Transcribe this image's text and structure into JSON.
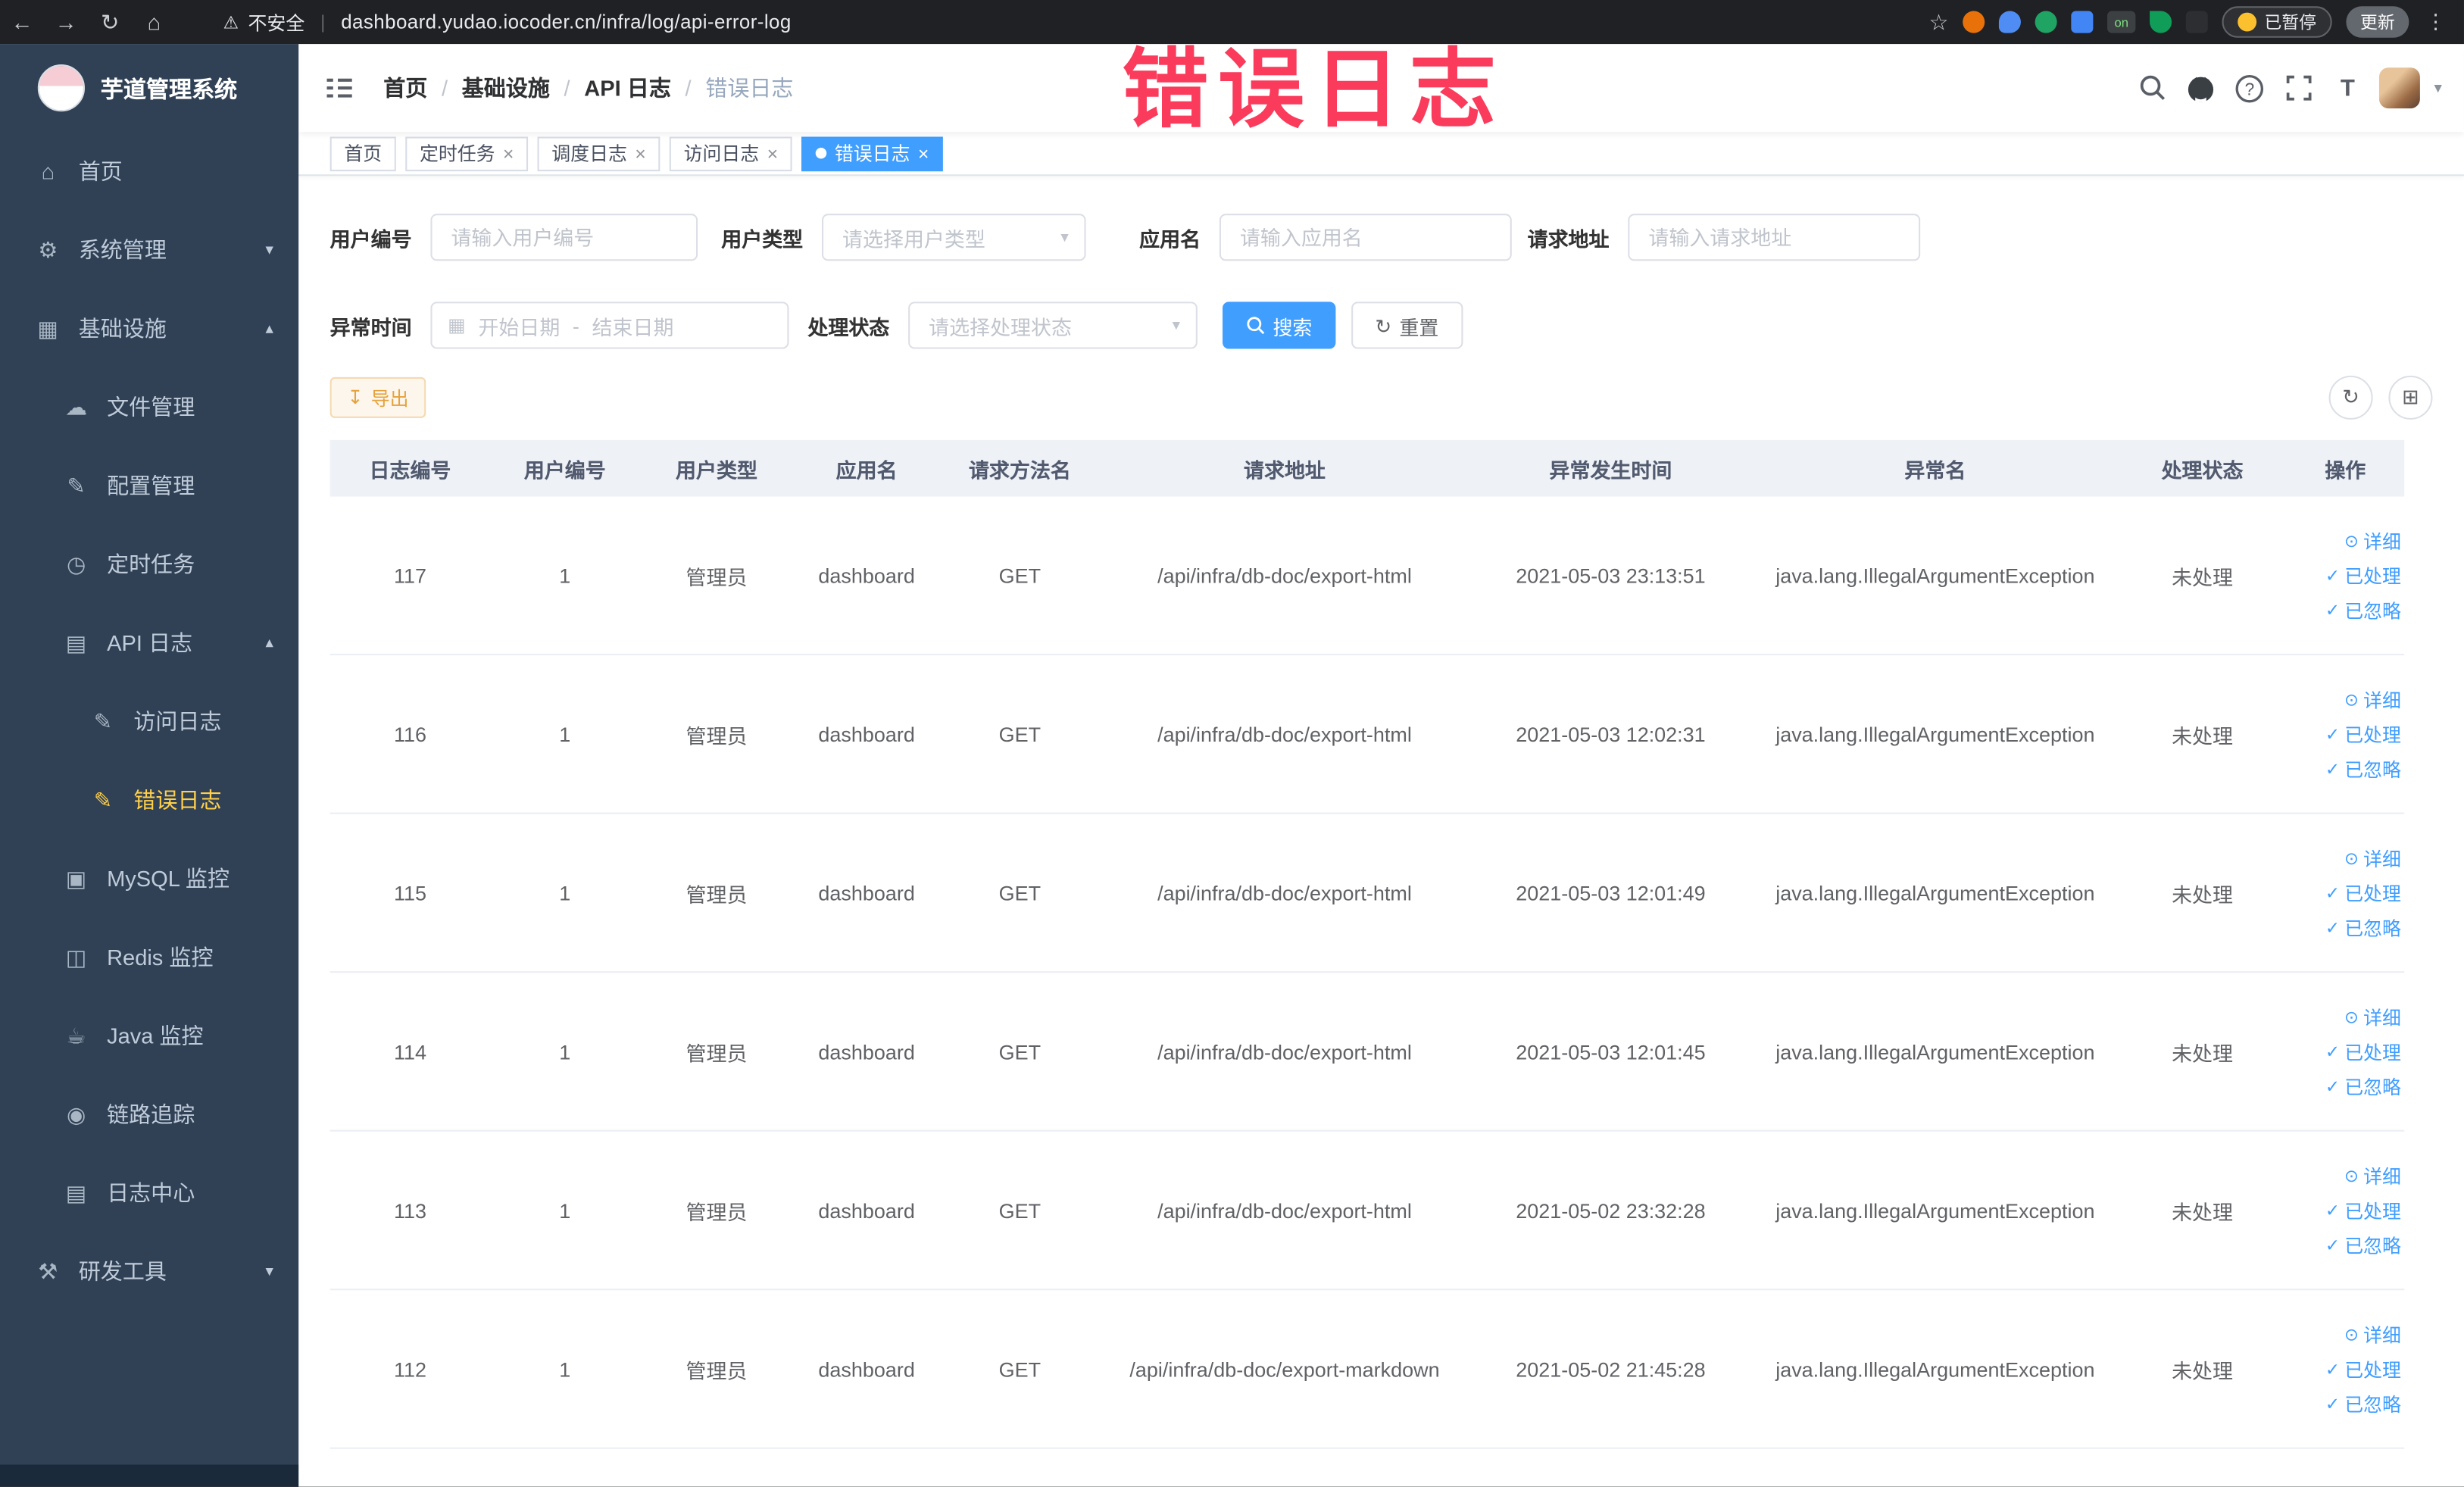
{
  "browser": {
    "back": "←",
    "forward": "→",
    "reload": "↻",
    "home": "⌂",
    "warning": "⚠",
    "security_label": "不安全",
    "url": "dashboard.yudao.iocoder.cn/infra/log/api-error-log",
    "star": "☆",
    "ext_on_badge": "on",
    "paused_label": "已暂停",
    "update_label": "更新",
    "kebab": "⋮"
  },
  "watermark": "错误日志",
  "sidebar": {
    "title": "芋道管理系统",
    "items": [
      {
        "label": "首页",
        "icon": "⌂"
      },
      {
        "label": "系统管理",
        "icon": "⚙"
      },
      {
        "label": "基础设施",
        "icon": "▦"
      },
      {
        "label": "文件管理",
        "icon": "☁"
      },
      {
        "label": "配置管理",
        "icon": "✎"
      },
      {
        "label": "定时任务",
        "icon": "◷"
      },
      {
        "label": "API 日志",
        "icon": "▤"
      },
      {
        "label": "访问日志",
        "icon": "✎"
      },
      {
        "label": "错误日志",
        "icon": "✎"
      },
      {
        "label": "MySQL 监控",
        "icon": "▣"
      },
      {
        "label": "Redis 监控",
        "icon": "◫"
      },
      {
        "label": "Java 监控",
        "icon": "☕"
      },
      {
        "label": "链路追踪",
        "icon": "◉"
      },
      {
        "label": "日志中心",
        "icon": "▤"
      },
      {
        "label": "研发工具",
        "icon": "⚒"
      }
    ]
  },
  "header": {
    "breadcrumb": [
      "首页",
      "基础设施",
      "API 日志",
      "错误日志"
    ],
    "separator": "/"
  },
  "tabs": [
    {
      "label": "首页"
    },
    {
      "label": "定时任务"
    },
    {
      "label": "调度日志"
    },
    {
      "label": "访问日志"
    },
    {
      "label": "错误日志"
    }
  ],
  "filters": {
    "user_id_label": "用户编号",
    "user_id_placeholder": "请输入用户编号",
    "user_type_label": "用户类型",
    "user_type_placeholder": "请选择用户类型",
    "app_label": "应用名",
    "app_placeholder": "请输入应用名",
    "req_label": "请求地址",
    "req_placeholder": "请输入请求地址",
    "time_label": "异常时间",
    "start_placeholder": "开始日期",
    "range_sep": "-",
    "end_placeholder": "结束日期",
    "status_label": "处理状态",
    "status_placeholder": "请选择处理状态",
    "search_label": "搜索",
    "reset_label": "重置"
  },
  "toolbar": {
    "export_label": "导出"
  },
  "table": {
    "columns": [
      "日志编号",
      "用户编号",
      "用户类型",
      "应用名",
      "请求方法名",
      "请求地址",
      "异常发生时间",
      "异常名",
      "处理状态",
      "操作"
    ],
    "action_labels": {
      "detail": "详细",
      "processed": "已处理",
      "ignored": "已忽略"
    },
    "rows": [
      {
        "id": "117",
        "user_id": "1",
        "user_type": "管理员",
        "app": "dashboard",
        "method": "GET",
        "url": "/api/infra/db-doc/export-html",
        "time": "2021-05-03 23:13:51",
        "exception": "java.lang.IllegalArgumentException",
        "status": "未处理"
      },
      {
        "id": "116",
        "user_id": "1",
        "user_type": "管理员",
        "app": "dashboard",
        "method": "GET",
        "url": "/api/infra/db-doc/export-html",
        "time": "2021-05-03 12:02:31",
        "exception": "java.lang.IllegalArgumentException",
        "status": "未处理"
      },
      {
        "id": "115",
        "user_id": "1",
        "user_type": "管理员",
        "app": "dashboard",
        "method": "GET",
        "url": "/api/infra/db-doc/export-html",
        "time": "2021-05-03 12:01:49",
        "exception": "java.lang.IllegalArgumentException",
        "status": "未处理"
      },
      {
        "id": "114",
        "user_id": "1",
        "user_type": "管理员",
        "app": "dashboard",
        "method": "GET",
        "url": "/api/infra/db-doc/export-html",
        "time": "2021-05-03 12:01:45",
        "exception": "java.lang.IllegalArgumentException",
        "status": "未处理"
      },
      {
        "id": "113",
        "user_id": "1",
        "user_type": "管理员",
        "app": "dashboard",
        "method": "GET",
        "url": "/api/infra/db-doc/export-html",
        "time": "2021-05-02 23:32:28",
        "exception": "java.lang.IllegalArgumentException",
        "status": "未处理"
      },
      {
        "id": "112",
        "user_id": "1",
        "user_type": "管理员",
        "app": "dashboard",
        "method": "GET",
        "url": "/api/infra/db-doc/export-markdown",
        "time": "2021-05-02 21:45:28",
        "exception": "java.lang.IllegalArgumentException",
        "status": "未处理"
      }
    ]
  },
  "icons": {
    "caret_down": "▾",
    "caret_up": "▴",
    "close": "×",
    "calendar": "▦",
    "reset": "↻",
    "export": "↧",
    "refresh": "↻",
    "columns": "⊞",
    "eye": "⊙",
    "check": "✓",
    "fontsize": "T"
  }
}
